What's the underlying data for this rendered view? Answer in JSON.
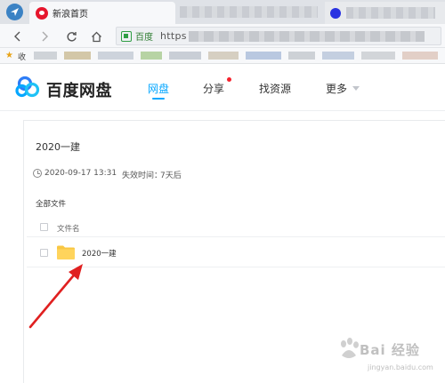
{
  "browser": {
    "active_tab_title": "新浪首页",
    "url_scheme": "https",
    "site_badge": "百度",
    "bookmarks_label": "收"
  },
  "app": {
    "logo_text": "百度网盘",
    "nav": {
      "netdisk": "网盘",
      "share": "分享",
      "find": "找资源",
      "more": "更多"
    },
    "colors": {
      "accent": "#06a7ff",
      "notification": "#f5222d"
    }
  },
  "share": {
    "title": "2020一建",
    "created": "2020-09-17 13:31",
    "expiry_label": "失效时间：",
    "expiry_value": "7天后",
    "breadcrumb": "全部文件",
    "column_name": "文件名",
    "files": [
      {
        "name": "2020一建",
        "type": "folder"
      }
    ]
  },
  "watermark": {
    "text": "Bai 经验",
    "sub": "jingyan.baidu.com"
  }
}
